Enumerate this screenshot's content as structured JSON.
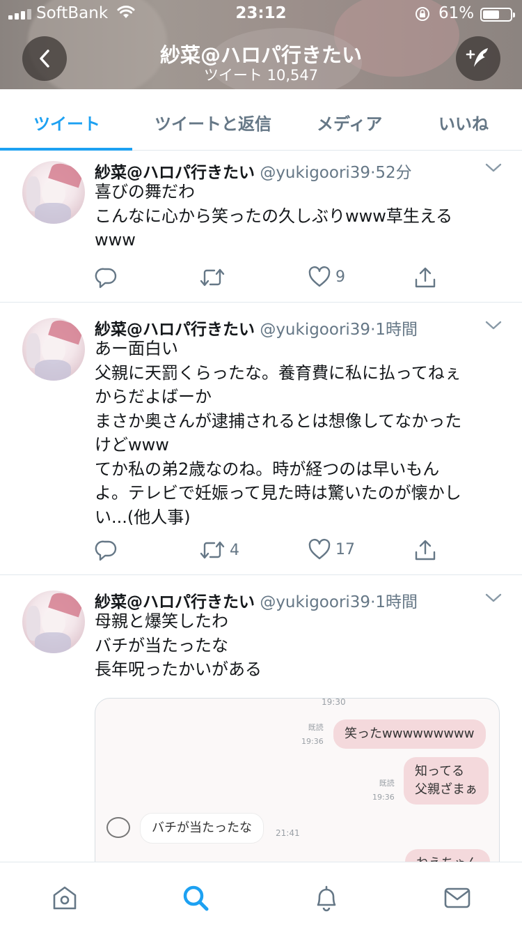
{
  "status_bar": {
    "carrier": "SoftBank",
    "time": "23:12",
    "battery_percent": "61%",
    "battery_level": 0.61
  },
  "header": {
    "title": "紗菜@ハロパ行きたい",
    "subtitle": "ツイート 10,547",
    "back_icon": "chevron-left-icon",
    "compose_icon": "compose-tweet-icon"
  },
  "tabs": [
    {
      "label": "ツイート",
      "active": true
    },
    {
      "label": "ツイートと返信",
      "active": false
    },
    {
      "label": "メディア",
      "active": false
    },
    {
      "label": "いいね",
      "active": false
    }
  ],
  "tweets": [
    {
      "name": "紗菜@ハロパ行きたい",
      "handle": "@yukigoori39",
      "sep": "·",
      "time": "52分",
      "lines": [
        "喜びの舞だわ",
        "こんなに心から笑ったの久しぶりwww草生える",
        "www"
      ],
      "reply_count": "",
      "retweet_count": "",
      "like_count": "9"
    },
    {
      "name": "紗菜@ハロパ行きたい",
      "handle": "@yukigoori39",
      "sep": "·",
      "time": "1時間",
      "lines": [
        "あー面白い",
        "父親に天罰くらったな。養育費に私に払ってねぇ",
        "からだよばーか",
        "まさか奥さんが逮捕されるとは想像してなかった",
        "けどwww",
        "てか私の弟2歳なのね。時が経つのは早いもん",
        "よ。テレビで妊娠って見た時は驚いたのが懐かし",
        "い...(他人事)"
      ],
      "reply_count": "",
      "retweet_count": "4",
      "like_count": "17"
    },
    {
      "name": "紗菜@ハロパ行きたい",
      "handle": "@yukigoori39",
      "sep": "·",
      "time": "1時間",
      "lines": [
        "母親と爆笑したわ",
        "バチが当たったな",
        "長年呪ったかいがある"
      ]
    }
  ],
  "media_chat": {
    "top_time": "19:30",
    "msg1": {
      "text": "笑ったwwwwwwwww",
      "read": "既読",
      "time": "19:36"
    },
    "msg2": {
      "line1": "知ってる",
      "line2": "父親ざまぁ",
      "read": "既読",
      "time": "19:36"
    },
    "msg3": {
      "text": "バチが当たったな",
      "time": "21:41"
    },
    "msg4_partial": "ねえちゃん"
  },
  "bottom_nav": [
    {
      "icon": "home-icon",
      "active": false
    },
    {
      "icon": "search-icon",
      "active": true
    },
    {
      "icon": "notifications-bell-icon",
      "active": false
    },
    {
      "icon": "messages-envelope-icon",
      "active": false
    }
  ],
  "colors": {
    "accent": "#1da1f2",
    "text": "#14171a",
    "muted": "#657786",
    "chat_bubble": "#f4d9dc"
  }
}
